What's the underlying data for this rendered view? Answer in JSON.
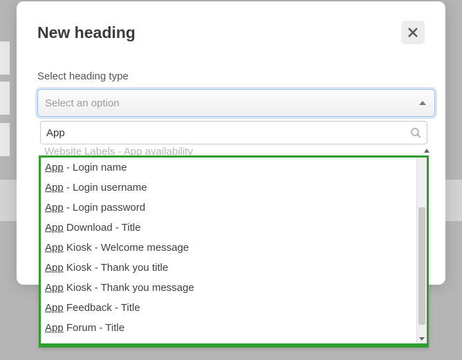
{
  "modal": {
    "title": "New heading",
    "field_label": "Select heading type",
    "placeholder": "Select an option"
  },
  "search": {
    "value": "App"
  },
  "partial_option": {
    "prefix": "Website Labels - ",
    "match": "App",
    "suffix": " availability"
  },
  "options": [
    {
      "match": "App",
      "rest": " - Login name"
    },
    {
      "match": "App",
      "rest": " - Login username"
    },
    {
      "match": "App",
      "rest": " - Login password"
    },
    {
      "match": "App",
      "rest": " Download - Title"
    },
    {
      "match": "App",
      "rest": " Kiosk - Welcome message"
    },
    {
      "match": "App",
      "rest": " Kiosk - Thank you title"
    },
    {
      "match": "App",
      "rest": " Kiosk - Thank you message"
    },
    {
      "match": "App",
      "rest": " Feedback - Title"
    },
    {
      "match": "App",
      "rest": " Forum - Title"
    }
  ],
  "colors": {
    "highlight_border": "#2e9e2e",
    "select_focus": "#9cc2e8"
  }
}
